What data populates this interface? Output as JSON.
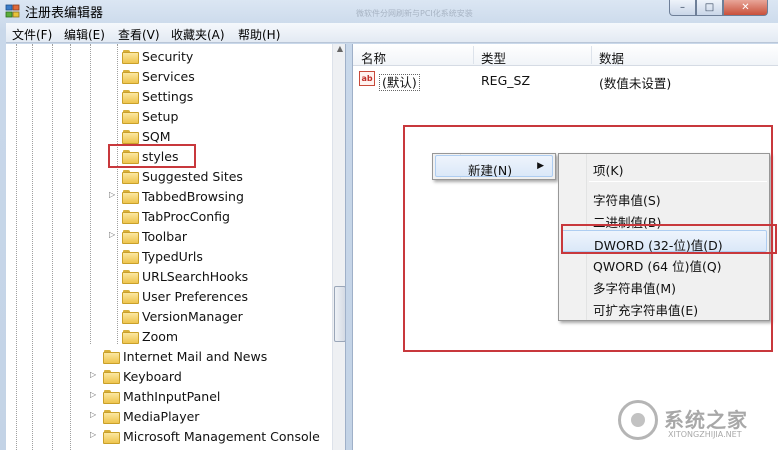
{
  "window": {
    "title": "注册表编辑器",
    "background_text": "微软件分网刷新与PCI化系统安装",
    "controls": {
      "minimize": "–",
      "maximize": "□",
      "close": "✕"
    }
  },
  "menubar": {
    "items": [
      "文件(F)",
      "编辑(E)",
      "查看(V)",
      "收藏夹(A)",
      "帮助(H)"
    ]
  },
  "tree": {
    "items": [
      {
        "label": "Security",
        "expandable": false
      },
      {
        "label": "Services",
        "expandable": false
      },
      {
        "label": "Settings",
        "expandable": false
      },
      {
        "label": "Setup",
        "expandable": false
      },
      {
        "label": "SQM",
        "expandable": false
      },
      {
        "label": "styles",
        "expandable": false,
        "highlighted": true
      },
      {
        "label": "Suggested Sites",
        "expandable": false
      },
      {
        "label": "TabbedBrowsing",
        "expandable": true
      },
      {
        "label": "TabProcConfig",
        "expandable": false
      },
      {
        "label": "Toolbar",
        "expandable": true
      },
      {
        "label": "TypedUrls",
        "expandable": false
      },
      {
        "label": "URLSearchHooks",
        "expandable": false
      },
      {
        "label": "User Preferences",
        "expandable": false
      },
      {
        "label": "VersionManager",
        "expandable": false
      },
      {
        "label": "Zoom",
        "expandable": false
      },
      {
        "label": "Internet Mail and News",
        "expandable": false
      },
      {
        "label": "Keyboard",
        "expandable": true
      },
      {
        "label": "MathInputPanel",
        "expandable": true
      },
      {
        "label": "MediaPlayer",
        "expandable": true
      },
      {
        "label": "Microsoft Management Console",
        "expandable": true
      }
    ]
  },
  "list": {
    "headers": {
      "name": "名称",
      "type": "类型",
      "data": "数据"
    },
    "rows": [
      {
        "icon": "ab",
        "name": "(默认)",
        "type": "REG_SZ",
        "data": "(数值未设置)"
      }
    ]
  },
  "context_menu": {
    "new_label": "新建(N)",
    "arrow": "▶"
  },
  "submenu": {
    "items": [
      "项(K)",
      "字符串值(S)",
      "二进制值(B)",
      "DWORD (32-位)值(D)",
      "QWORD (64 位)值(Q)",
      "多字符串值(M)",
      "可扩充字符串值(E)"
    ],
    "highlighted_index": 3
  },
  "watermark": {
    "text": "系统之家",
    "url": "XITONGZHIJIA.NET"
  },
  "colors": {
    "highlight_box": "#c8383c",
    "menu_highlight": "#dbe8f8"
  }
}
